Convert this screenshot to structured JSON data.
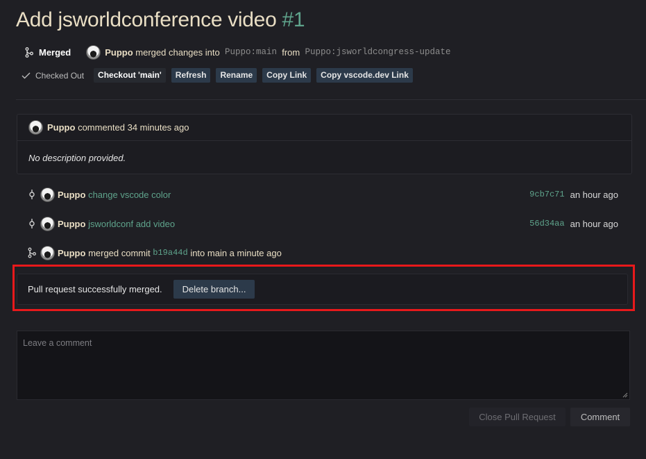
{
  "pr": {
    "title": "Add jsworldconference video",
    "number": "#1",
    "state": "Merged",
    "author": "Puppo",
    "merged_text": "merged changes into",
    "target_branch": "Puppo:main",
    "from_text": "from",
    "source_branch": "Puppo:jsworldcongress-update"
  },
  "actions": {
    "checked_out": "Checked Out",
    "checkout_main": "Checkout 'main'",
    "refresh": "Refresh",
    "rename": "Rename",
    "copy_link": "Copy Link",
    "copy_vscode_link": "Copy vscode.dev Link"
  },
  "comment": {
    "author": "Puppo",
    "meta": "commented 34 minutes ago",
    "body": "No description provided."
  },
  "timeline": [
    {
      "author": "Puppo",
      "message": "change vscode color",
      "hash": "9cb7c71",
      "time": "an hour ago"
    },
    {
      "author": "Puppo",
      "message": "jsworldconf add video",
      "hash": "56d34aa",
      "time": "an hour ago"
    }
  ],
  "merge_event": {
    "author": "Puppo",
    "text1": "merged commit",
    "hash": "b19a44d",
    "text2": "into main a minute ago"
  },
  "merged_box": {
    "message": "Pull request successfully merged.",
    "delete_label": "Delete branch..."
  },
  "new_comment": {
    "placeholder": "Leave a comment",
    "close_label": "Close Pull Request",
    "comment_label": "Comment"
  },
  "colors": {
    "accent": "#5fa48c",
    "highlight": "#e8191b"
  }
}
